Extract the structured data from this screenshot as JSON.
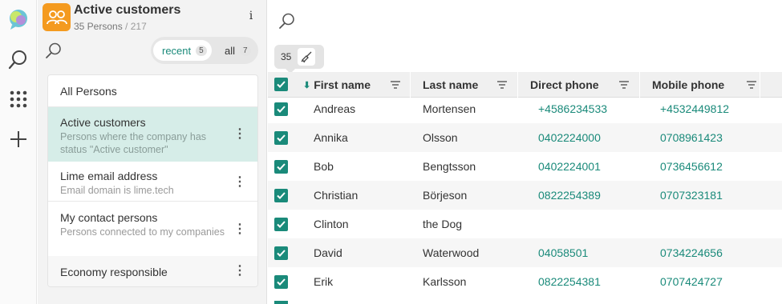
{
  "rail": {
    "items": [
      "chat-logo-icon",
      "search-icon",
      "apps-grid-icon",
      "plus-icon"
    ]
  },
  "panel": {
    "title": "Active customers",
    "count_label": "35 Persons",
    "total_label": "/ 217",
    "info_label": "i",
    "segment": {
      "recent_label": "recent",
      "recent_count": "5",
      "all_label": "all",
      "all_count": "7"
    },
    "filters": [
      {
        "title": "All Persons",
        "desc": ""
      },
      {
        "title": "Active customers",
        "desc": "Persons where the company has status \"Active customer\""
      },
      {
        "title": "Lime email address",
        "desc": "Email domain is lime.tech"
      },
      {
        "title": "My contact persons",
        "desc": "Persons connected to my companies"
      },
      {
        "title": "Economy responsible",
        "desc": ""
      }
    ]
  },
  "main": {
    "selected_count": "35",
    "columns": [
      "First name",
      "Last name",
      "Direct phone",
      "Mobile phone"
    ],
    "rows": [
      {
        "first": "Andreas",
        "last": "Mortensen",
        "direct": "+4586234533",
        "mobile": "+4532449812"
      },
      {
        "first": "Annika",
        "last": "Olsson",
        "direct": "0402224000",
        "mobile": "0708961423"
      },
      {
        "first": "Bob",
        "last": "Bengtsson",
        "direct": "0402224001",
        "mobile": "0736456612"
      },
      {
        "first": "Christian",
        "last": "Börjeson",
        "direct": "0822254389",
        "mobile": "0707323181"
      },
      {
        "first": "Clinton",
        "last": "the Dog",
        "direct": "",
        "mobile": ""
      },
      {
        "first": "David",
        "last": "Waterwood",
        "direct": "04058501",
        "mobile": "0734224656"
      },
      {
        "first": "Erik",
        "last": "Karlsson",
        "direct": "0822254381",
        "mobile": "0707424727"
      }
    ]
  },
  "colors": {
    "accent": "#1a8a7a",
    "brand_orange": "#f49a1f",
    "selected_filter_bg": "#d6ede8"
  }
}
